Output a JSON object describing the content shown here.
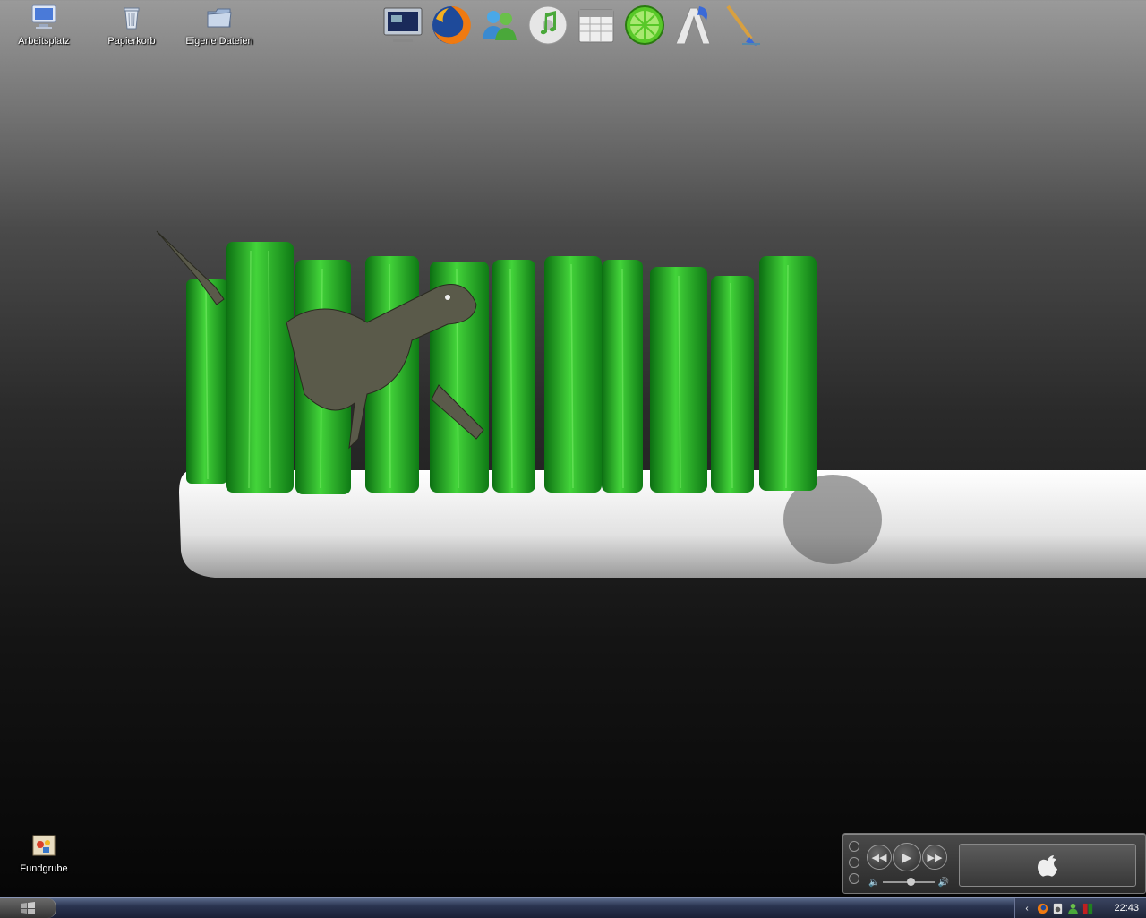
{
  "desktop_icons": {
    "arbeitsplatz": "Arbeitsplatz",
    "papierkorb": "Papierkorb",
    "eigene_dateien": "Eigene Dateien",
    "fundgrube": "Fundgrube"
  },
  "dock": {
    "items": [
      "desktop-monitor-icon",
      "firefox-icon",
      "messenger-icon",
      "itunes-icon",
      "calendar-icon",
      "lime-icon",
      "font-icon",
      "paint-brush-icon"
    ]
  },
  "player": {
    "prev_icon": "rewind-icon",
    "play_icon": "play-icon",
    "next_icon": "fast-forward-icon",
    "display_icon": "apple-logo-icon",
    "volume_level": 0.46
  },
  "taskbar": {
    "clock": "22:43",
    "tray_icons": [
      "chevron-left-icon",
      "firefox-tray-icon",
      "speaker-tray-icon",
      "user-tray-icon",
      "meter-tray-icon"
    ]
  },
  "colors": {
    "accent_green": "#2fb52a",
    "taskbar": "#2a3450"
  }
}
